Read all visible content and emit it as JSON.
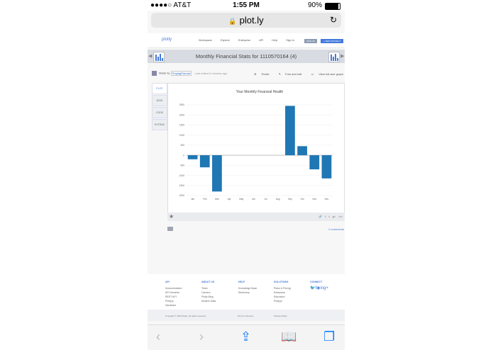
{
  "status": {
    "carrier": "●●●●○ AT&T",
    "time": "1:55 PM",
    "battery": "90%",
    "battery_level": 0.9
  },
  "browser": {
    "url": "plot.ly"
  },
  "site": {
    "logo": "plotly",
    "nav": [
      "Workspace",
      "Explore",
      "Enterprise",
      "API",
      "Help",
      "Sign In"
    ],
    "signup": "SIGN UP",
    "new_project": "+ NEW PROJECT"
  },
  "plot_title": "Monthly Financial Stats for 1110570164 (4)",
  "made_by": {
    "label": "Made by",
    "user": "PrayagParmar",
    "edited": "Last edited 6 minutes ago"
  },
  "actions": [
    "Public",
    "Fork and edit",
    "View full-size graph"
  ],
  "side_tabs": [
    "PLOT",
    "DATA",
    "CODE",
    "EXTRAS"
  ],
  "comments": "0 comments",
  "footer": {
    "columns": [
      {
        "heading": "API",
        "items": [
          "Documentation",
          "API Libraries",
          "REST API",
          "Plotly.js",
          "Hardware"
        ]
      },
      {
        "heading": "ABOUT US",
        "items": [
          "Team",
          "Careers",
          "Plotly Blog",
          "Modern Data"
        ]
      },
      {
        "heading": "HELP",
        "items": [
          "Knowledge Base",
          "Workshop"
        ]
      },
      {
        "heading": "SOLUTIONS",
        "items": [
          "Plans & Pricing",
          "Enterprise",
          "Education",
          "Plotly.js"
        ]
      },
      {
        "heading": "CONNECT",
        "items": []
      }
    ],
    "social_icons": [
      "twitter-icon",
      "facebook-icon",
      "github-icon",
      "linkedin-icon",
      "google-plus-icon"
    ],
    "copyright": "Copyright © 2015 Plotly. All rights reserved.",
    "terms": "Terms of Service",
    "privacy": "Privacy Policy"
  },
  "chart_data": {
    "type": "bar",
    "title": "Your Monthly Financial Health",
    "categories": [
      "Jan",
      "Feb",
      "Mar",
      "Apr",
      "May",
      "Jun",
      "Jul",
      "Aug",
      "Sep",
      "Oct",
      "Nov",
      "Dec"
    ],
    "values": [
      -200,
      -600,
      -1800,
      0,
      0,
      0,
      0,
      0,
      2450,
      450,
      -700,
      -1150
    ],
    "yticks": [
      2500,
      2000,
      1500,
      1000,
      500,
      0,
      -500,
      -1000,
      -1500,
      -2000
    ],
    "ylim": [
      -2000,
      2500
    ],
    "bar_color": "#1f77b4",
    "grid": true
  }
}
